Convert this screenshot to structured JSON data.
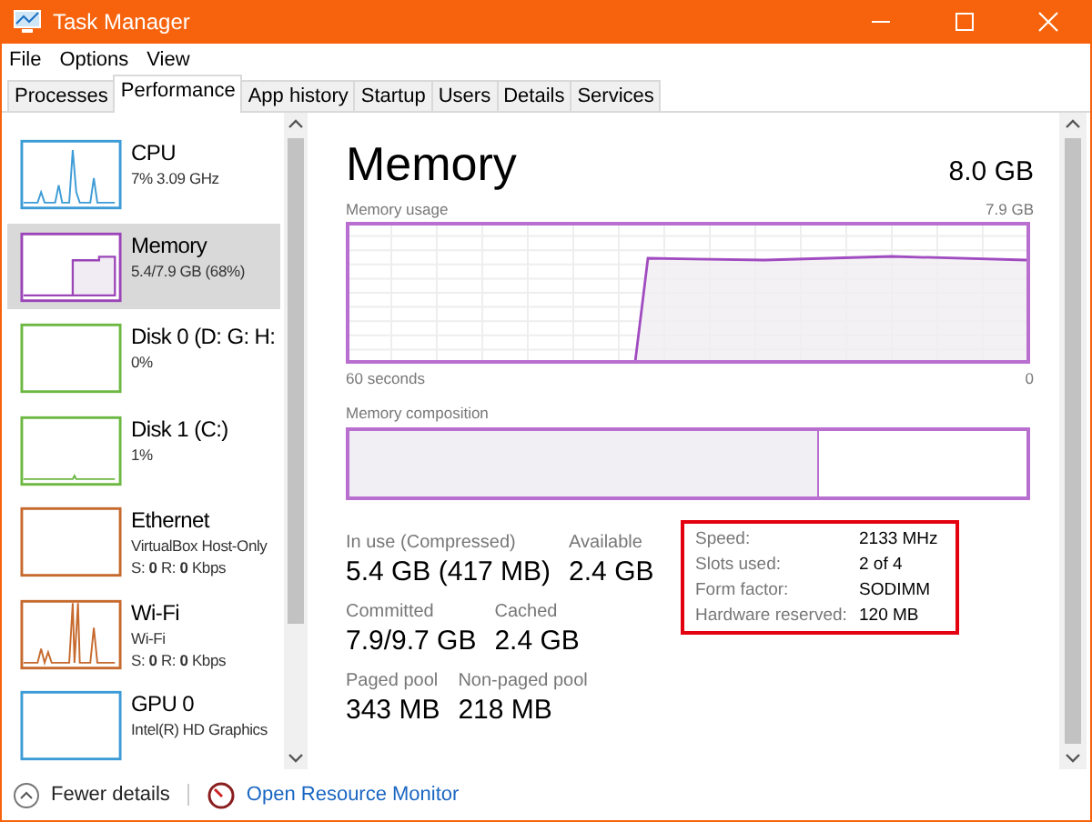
{
  "window": {
    "title": "Task Manager"
  },
  "menu": [
    "File",
    "Options",
    "View"
  ],
  "tabs": [
    {
      "label": "Processes",
      "selected": false
    },
    {
      "label": "Performance",
      "selected": true
    },
    {
      "label": "App history",
      "selected": false
    },
    {
      "label": "Startup",
      "selected": false
    },
    {
      "label": "Users",
      "selected": false
    },
    {
      "label": "Details",
      "selected": false
    },
    {
      "label": "Services",
      "selected": false
    }
  ],
  "sidebar": {
    "items": [
      {
        "name": "CPU",
        "details": [
          "7% 3.09 GHz"
        ],
        "color": "#3d9bd6",
        "selected": false
      },
      {
        "name": "Memory",
        "details": [
          "5.4/7.9 GB (68%)"
        ],
        "color": "#9b45b8",
        "selected": true
      },
      {
        "name": "Disk 0 (D: G: H:",
        "details": [
          "0%"
        ],
        "color": "#6cb842",
        "selected": false
      },
      {
        "name": "Disk 1 (C:)",
        "details": [
          "1%"
        ],
        "color": "#6cb842",
        "selected": false
      },
      {
        "name": "Ethernet",
        "details": [
          "VirtualBox Host-Only",
          "S: **0** R: **0** Kbps"
        ],
        "color": "#c66a2e",
        "selected": false
      },
      {
        "name": "Wi-Fi",
        "details": [
          "Wi-Fi",
          "S: **0** R: **0** Kbps"
        ],
        "color": "#c66a2e",
        "selected": false
      },
      {
        "name": "GPU 0",
        "details": [
          "Intel(R) HD Graphics"
        ],
        "color": "#3d9bd6",
        "selected": false
      }
    ]
  },
  "memory": {
    "title": "Memory",
    "total": "8.0 GB",
    "usage_chart": {
      "label": "Memory usage",
      "max": "7.9 GB",
      "x_start": "60 seconds",
      "x_end": "0"
    },
    "composition": {
      "label": "Memory composition",
      "level": 0.69
    },
    "stats": [
      [
        {
          "label": "In use (Compressed)",
          "value": "5.4 GB (417 MB)"
        },
        {
          "label": "Available",
          "value": "2.4 GB"
        }
      ],
      [
        {
          "label": "Committed",
          "value": "7.9/9.7 GB"
        },
        {
          "label": "Cached",
          "value": "2.4 GB"
        }
      ],
      [
        {
          "label": "Paged pool",
          "value": "343 MB"
        },
        {
          "label": "Non-paged pool",
          "value": "218 MB"
        }
      ]
    ],
    "hardware": [
      {
        "label": "Speed:",
        "value": "2133 MHz"
      },
      {
        "label": "Slots used:",
        "value": "2 of 4"
      },
      {
        "label": "Form factor:",
        "value": "SODIMM"
      },
      {
        "label": "Hardware reserved:",
        "value": "120 MB"
      }
    ]
  },
  "footer": {
    "fewer_details": "Fewer details",
    "link": "Open Resource Monitor"
  }
}
